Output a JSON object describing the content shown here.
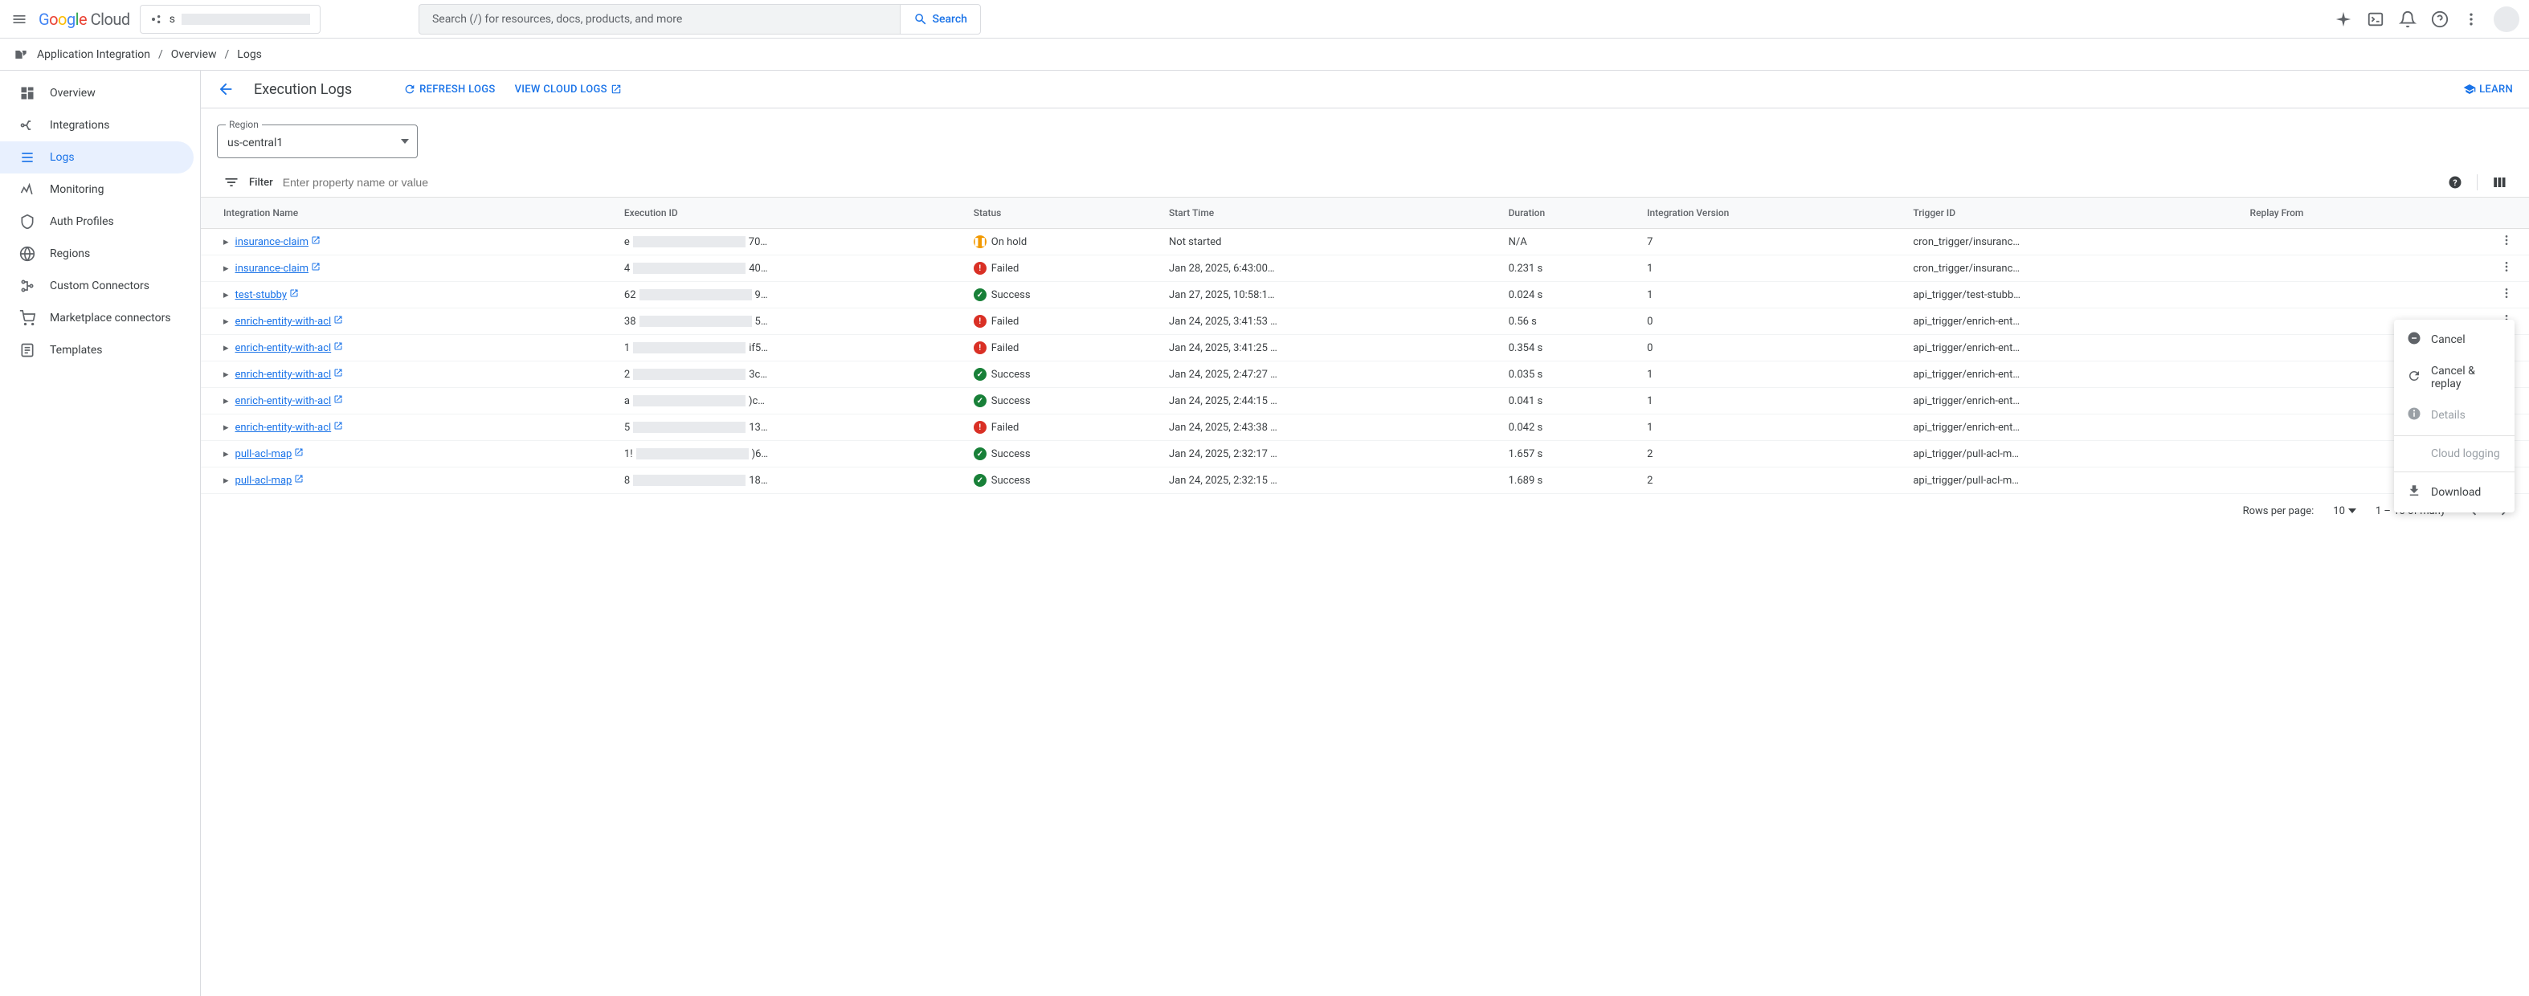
{
  "header": {
    "logo_text_parts": [
      "G",
      "o",
      "o",
      "g",
      "l",
      "e",
      " Cloud"
    ],
    "project_prefix": "s",
    "search_placeholder": "Search (/) for resources, docs, products, and more",
    "search_button": "Search"
  },
  "breadcrumb": {
    "product": "Application Integration",
    "items": [
      "Overview",
      "Logs"
    ]
  },
  "sidebar": {
    "items": [
      {
        "label": "Overview",
        "icon": "dashboard"
      },
      {
        "label": "Integrations",
        "icon": "integrations"
      },
      {
        "label": "Logs",
        "icon": "logs",
        "active": true
      },
      {
        "label": "Monitoring",
        "icon": "monitoring"
      },
      {
        "label": "Auth Profiles",
        "icon": "auth"
      },
      {
        "label": "Regions",
        "icon": "regions"
      },
      {
        "label": "Custom Connectors",
        "icon": "connectors"
      },
      {
        "label": "Marketplace connectors",
        "icon": "marketplace"
      },
      {
        "label": "Templates",
        "icon": "templates"
      }
    ]
  },
  "toolbar": {
    "page_title": "Execution Logs",
    "refresh": "Refresh Logs",
    "view_cloud": "View Cloud Logs",
    "learn": "Learn"
  },
  "region": {
    "label": "Region",
    "value": "us-central1"
  },
  "filter": {
    "label": "Filter",
    "placeholder": "Enter property name or value"
  },
  "table": {
    "headers": [
      "Integration Name",
      "Execution ID",
      "Status",
      "Start Time",
      "Duration",
      "Integration Version",
      "Trigger ID",
      "Replay From",
      ""
    ],
    "rows": [
      {
        "name": "insurance-claim",
        "exec_pre": "e",
        "exec_suf": "70…",
        "status": "On hold",
        "status_type": "hold",
        "start": "Not started",
        "duration": "N/A",
        "version": "7",
        "trigger": "cron_trigger/insuranc…",
        "replay": ""
      },
      {
        "name": "insurance-claim",
        "exec_pre": "4",
        "exec_suf": "40…",
        "status": "Failed",
        "status_type": "failed",
        "start": "Jan 28, 2025, 6:43:00…",
        "duration": "0.231 s",
        "version": "1",
        "trigger": "cron_trigger/insuranc…",
        "replay": ""
      },
      {
        "name": "test-stubby",
        "exec_pre": "62",
        "exec_suf": "9…",
        "status": "Success",
        "status_type": "success",
        "start": "Jan 27, 2025, 10:58:1…",
        "duration": "0.024 s",
        "version": "1",
        "trigger": "api_trigger/test-stubb…",
        "replay": ""
      },
      {
        "name": "enrich-entity-with-acl",
        "exec_pre": "38",
        "exec_suf": "5…",
        "status": "Failed",
        "status_type": "failed",
        "start": "Jan 24, 2025, 3:41:53 …",
        "duration": "0.56 s",
        "version": "0",
        "trigger": "api_trigger/enrich-ent…",
        "replay": ""
      },
      {
        "name": "enrich-entity-with-acl",
        "exec_pre": "1",
        "exec_suf": "if5…",
        "status": "Failed",
        "status_type": "failed",
        "start": "Jan 24, 2025, 3:41:25 …",
        "duration": "0.354 s",
        "version": "0",
        "trigger": "api_trigger/enrich-ent…",
        "replay": ""
      },
      {
        "name": "enrich-entity-with-acl",
        "exec_pre": "2",
        "exec_suf": "3c…",
        "status": "Success",
        "status_type": "success",
        "start": "Jan 24, 2025, 2:47:27 …",
        "duration": "0.035 s",
        "version": "1",
        "trigger": "api_trigger/enrich-ent…",
        "replay": ""
      },
      {
        "name": "enrich-entity-with-acl",
        "exec_pre": "a",
        "exec_suf": ")c…",
        "status": "Success",
        "status_type": "success",
        "start": "Jan 24, 2025, 2:44:15 …",
        "duration": "0.041 s",
        "version": "1",
        "trigger": "api_trigger/enrich-ent…",
        "replay": ""
      },
      {
        "name": "enrich-entity-with-acl",
        "exec_pre": "5",
        "exec_suf": "13…",
        "status": "Failed",
        "status_type": "failed",
        "start": "Jan 24, 2025, 2:43:38 …",
        "duration": "0.042 s",
        "version": "1",
        "trigger": "api_trigger/enrich-ent…",
        "replay": ""
      },
      {
        "name": "pull-acl-map",
        "exec_pre": "1!",
        "exec_suf": ")6…",
        "status": "Success",
        "status_type": "success",
        "start": "Jan 24, 2025, 2:32:17 …",
        "duration": "1.657 s",
        "version": "2",
        "trigger": "api_trigger/pull-acl-m…",
        "replay": ""
      },
      {
        "name": "pull-acl-map",
        "exec_pre": "8",
        "exec_suf": "18…",
        "status": "Success",
        "status_type": "success",
        "start": "Jan 24, 2025, 2:32:15 …",
        "duration": "1.689 s",
        "version": "2",
        "trigger": "api_trigger/pull-acl-m…",
        "replay": ""
      }
    ]
  },
  "pagination": {
    "rows_label": "Rows per page:",
    "rows_value": "10",
    "range": "1 – 10 of many"
  },
  "context_menu": {
    "items": [
      {
        "label": "Cancel",
        "icon": "cancel",
        "disabled": false
      },
      {
        "label": "Cancel & replay",
        "icon": "replay",
        "disabled": false
      },
      {
        "label": "Details",
        "icon": "info",
        "disabled": true
      },
      {
        "divider": true
      },
      {
        "label": "Cloud logging",
        "icon": "",
        "disabled": true
      },
      {
        "divider": true
      },
      {
        "label": "Download",
        "icon": "download",
        "disabled": false
      }
    ]
  }
}
